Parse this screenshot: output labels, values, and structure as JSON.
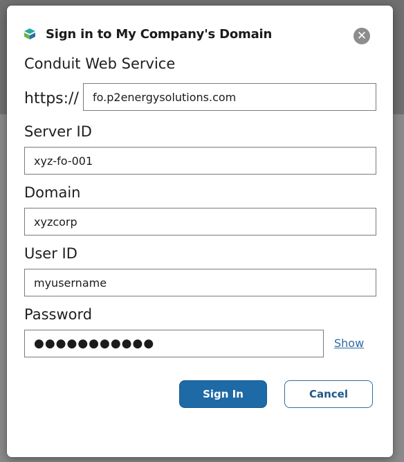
{
  "dialog": {
    "title": "Sign in to My Company's Domain",
    "logo_icon": "conduit-logo-icon",
    "close_icon": "close-icon",
    "close_glyph": "✕"
  },
  "service": {
    "label": "Conduit Web Service",
    "prefix": "https://",
    "value": "fo.p2energysolutions.com"
  },
  "server_id": {
    "label": "Server ID",
    "value": "xyz-fo-001"
  },
  "domain": {
    "label": "Domain",
    "value": "xyzcorp"
  },
  "user_id": {
    "label": "User ID",
    "value": "myusername"
  },
  "password": {
    "label": "Password",
    "value": "●●●●●●●●●●●",
    "show_label": "Show"
  },
  "buttons": {
    "sign_in": "Sign In",
    "cancel": "Cancel"
  },
  "colors": {
    "primary": "#1e6aa6",
    "link": "#2d6aa3",
    "logo_teal": "#27a9a0",
    "logo_blue": "#2b6ea6",
    "logo_green": "#5fb84a"
  }
}
